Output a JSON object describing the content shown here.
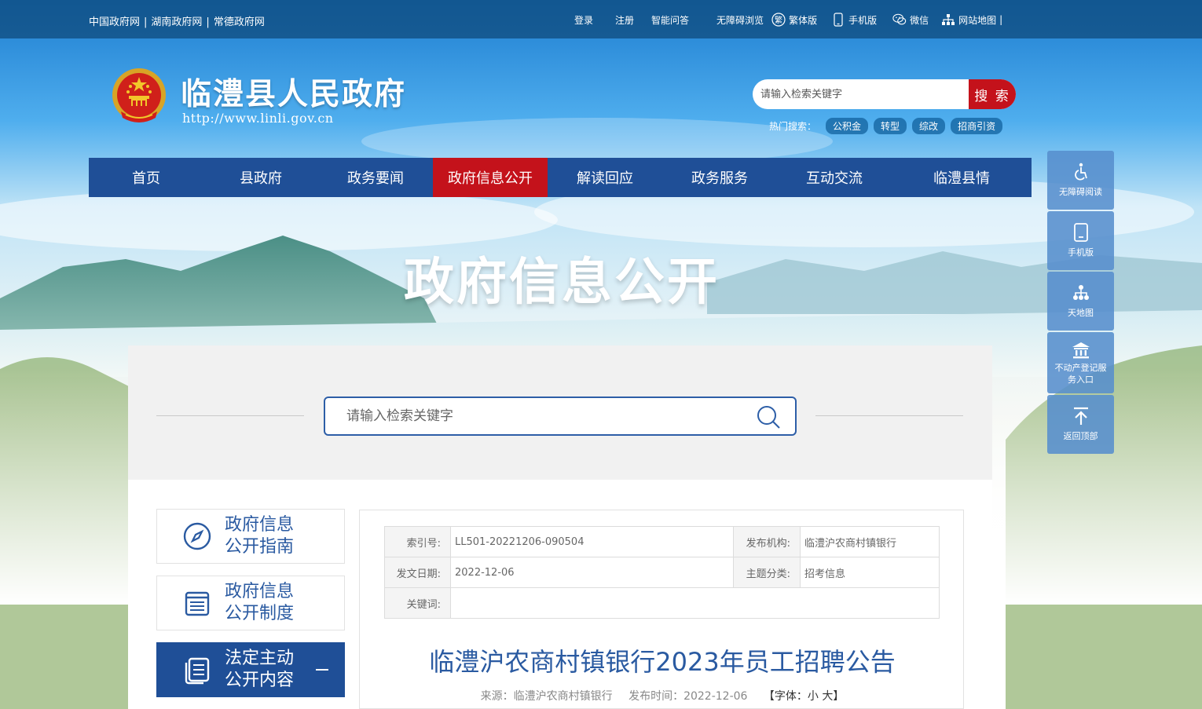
{
  "topbar": {
    "left_links": [
      "中国政府网",
      "湖南政府网",
      "常德政府网"
    ],
    "separator": "|",
    "right_links": {
      "login": "登录",
      "register": "注册",
      "smart_qa": "智能问答",
      "accessible": "无障碍浏览",
      "traditional": "繁体版",
      "traditional_icon_char": "繁",
      "mobile": "手机版",
      "wechat": "微信",
      "sitemap": "网站地图",
      "trailing_sep": "|"
    }
  },
  "header": {
    "title": "临澧县人民政府",
    "url": "http://www.linli.gov.cn",
    "search_placeholder": "请输入检索关键字",
    "search_button": "搜 索",
    "hot_label": "热门搜索：",
    "hot_tags": [
      "公积金",
      "转型",
      "综改",
      "招商引资"
    ]
  },
  "nav": {
    "items": [
      "首页",
      "县政府",
      "政务要闻",
      "政府信息公开",
      "解读回应",
      "政务服务",
      "互动交流",
      "临澧县情"
    ],
    "active_index": 3
  },
  "banner": {
    "title": "政府信息公开"
  },
  "floatbar": {
    "items": [
      "无障碍阅读",
      "手机版",
      "天地图",
      "不动产登记服务入口",
      "返回顶部"
    ]
  },
  "panel": {
    "search_placeholder": "请输入检索关键字"
  },
  "side_menu": {
    "items": [
      {
        "line1": "政府信息",
        "line2": "公开指南"
      },
      {
        "line1": "政府信息",
        "line2": "公开制度"
      },
      {
        "line1": "法定主动",
        "line2": "公开内容"
      }
    ],
    "active_index": 2
  },
  "doc": {
    "meta": {
      "index_label": "索引号:",
      "index_value": "LL501-20221206-090504",
      "publisher_label": "发布机构:",
      "publisher_value": "临澧沪农商村镇银行",
      "date_label": "发文日期:",
      "date_value": "2022-12-06",
      "topic_label": "主题分类:",
      "topic_value": "招考信息",
      "keywords_label": "关键词:",
      "keywords_value": ""
    },
    "title": "临澧沪农商村镇银行2023年员工招聘公告",
    "source": "来源：临澧沪农商村镇银行",
    "publish_time": "发布时间：2022-12-06",
    "font_size": "【字体：小 大】"
  },
  "colors": {
    "nav_bg": "#1f4f97",
    "active_red": "#c4121b",
    "link_blue": "#2a5aa1"
  }
}
